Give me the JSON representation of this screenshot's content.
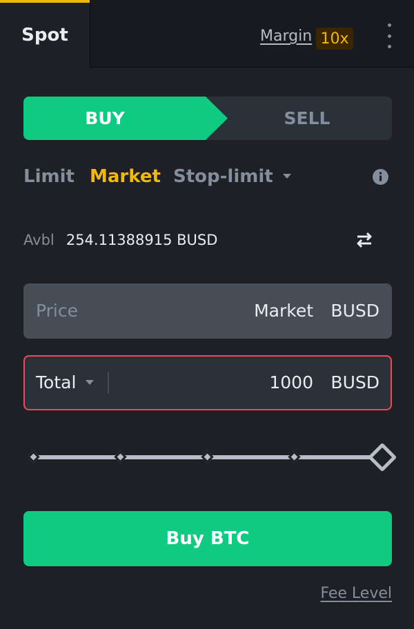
{
  "colors": {
    "background": "#1e2026",
    "buy_green": "#0ecb81",
    "accent_yellow": "#f0b90b",
    "error_red": "#f6465d",
    "muted_text": "#848e9c"
  },
  "tabs": {
    "spot_label": "Spot",
    "margin_label": "Margin",
    "leverage_badge": "10x",
    "more_icon": "more-vertical-icon"
  },
  "side": {
    "buy_label": "BUY",
    "sell_label": "SELL",
    "selected": "BUY"
  },
  "order_types": {
    "limit": "Limit",
    "market": "Market",
    "stop_limit": "Stop-limit",
    "selected": "Market",
    "info_icon": "info-icon"
  },
  "available": {
    "label": "Avbl",
    "value": "254.11388915 BUSD",
    "swap_icon": "transfer-arrows-icon"
  },
  "price": {
    "label": "Price",
    "value": "Market",
    "unit": "BUSD"
  },
  "total": {
    "select_label": "Total",
    "value": "1000",
    "unit": "BUSD"
  },
  "slider": {
    "percent": 100,
    "marks": [
      0,
      25,
      50,
      75,
      100
    ]
  },
  "action": {
    "buy_button_label": "Buy BTC"
  },
  "footer": {
    "fee_level_label": "Fee Level"
  }
}
